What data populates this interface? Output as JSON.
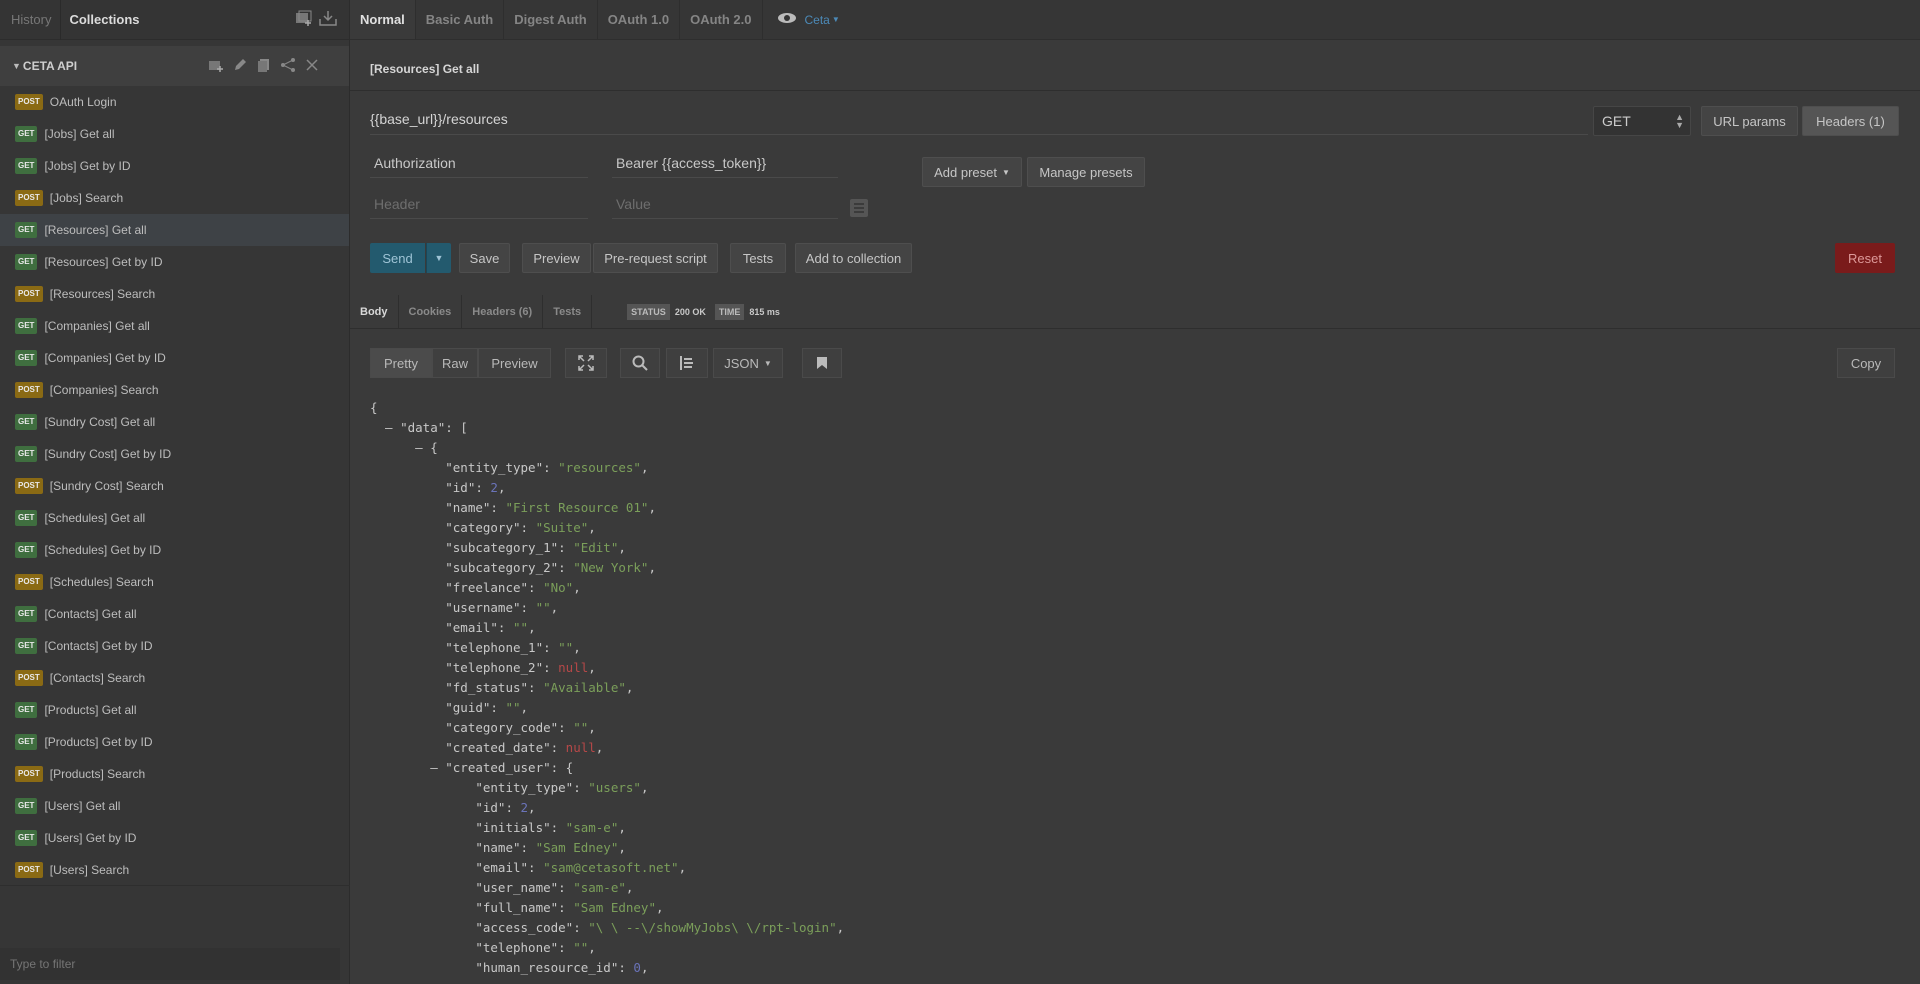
{
  "sidebar": {
    "tabs": [
      {
        "label": "History"
      },
      {
        "label": "Collections"
      }
    ],
    "collection_name": "CETA API",
    "filter_placeholder": "Type to filter",
    "requests": [
      {
        "method": "POST",
        "label": "OAuth Login"
      },
      {
        "method": "GET",
        "label": "[Jobs] Get all"
      },
      {
        "method": "GET",
        "label": "[Jobs] Get by ID"
      },
      {
        "method": "POST",
        "label": "[Jobs] Search"
      },
      {
        "method": "GET",
        "label": "[Resources] Get all"
      },
      {
        "method": "GET",
        "label": "[Resources] Get by ID"
      },
      {
        "method": "POST",
        "label": "[Resources] Search"
      },
      {
        "method": "GET",
        "label": "[Companies] Get all"
      },
      {
        "method": "GET",
        "label": "[Companies] Get by ID"
      },
      {
        "method": "POST",
        "label": "[Companies] Search"
      },
      {
        "method": "GET",
        "label": "[Sundry Cost] Get all"
      },
      {
        "method": "GET",
        "label": "[Sundry Cost] Get by ID"
      },
      {
        "method": "POST",
        "label": "[Sundry Cost] Search"
      },
      {
        "method": "GET",
        "label": "[Schedules] Get all"
      },
      {
        "method": "GET",
        "label": "[Schedules] Get by ID"
      },
      {
        "method": "POST",
        "label": "[Schedules] Search"
      },
      {
        "method": "GET",
        "label": "[Contacts] Get all"
      },
      {
        "method": "GET",
        "label": "[Contacts] Get by ID"
      },
      {
        "method": "POST",
        "label": "[Contacts] Search"
      },
      {
        "method": "GET",
        "label": "[Products] Get all"
      },
      {
        "method": "GET",
        "label": "[Products] Get by ID"
      },
      {
        "method": "POST",
        "label": "[Products] Search"
      },
      {
        "method": "GET",
        "label": "[Users] Get all"
      },
      {
        "method": "GET",
        "label": "[Users] Get by ID"
      },
      {
        "method": "POST",
        "label": "[Users] Search"
      }
    ],
    "active_index": 4
  },
  "auth_tabs": [
    {
      "label": "Normal"
    },
    {
      "label": "Basic Auth"
    },
    {
      "label": "Digest Auth"
    },
    {
      "label": "OAuth 1.0"
    },
    {
      "label": "OAuth 2.0"
    }
  ],
  "environment": "Ceta",
  "request": {
    "title": "[Resources] Get all",
    "url": "{{base_url}}/resources",
    "method": "GET",
    "url_params_label": "URL params",
    "headers_label": "Headers (1)",
    "header_key": "Authorization",
    "header_value": "Bearer {{access_token}}",
    "header_placeholder": "Header",
    "value_placeholder": "Value",
    "add_preset": "Add preset",
    "manage_presets": "Manage presets"
  },
  "actions": {
    "send": "Send",
    "save": "Save",
    "preview": "Preview",
    "prerequest": "Pre-request script",
    "tests": "Tests",
    "add_to_collection": "Add to collection",
    "reset": "Reset"
  },
  "response": {
    "tabs": [
      {
        "label": "Body"
      },
      {
        "label": "Cookies"
      },
      {
        "label": "Headers (6)"
      },
      {
        "label": "Tests"
      }
    ],
    "status_tag": "STATUS",
    "status": "200 OK",
    "time_tag": "TIME",
    "time": "815 ms",
    "view_modes": [
      {
        "label": "Pretty"
      },
      {
        "label": "Raw"
      },
      {
        "label": "Preview"
      }
    ],
    "format": "JSON",
    "copy": "Copy"
  },
  "json_lines": [
    [
      {
        "t": "jt",
        "v": "{"
      }
    ],
    [
      {
        "t": "jt",
        "v": "  – \"data\": ["
      }
    ],
    [
      {
        "t": "jt",
        "v": "      – {"
      }
    ],
    [
      {
        "t": "jk",
        "v": "          \"entity_type\": "
      },
      {
        "t": "js",
        "v": "\"resources\""
      },
      {
        "t": "jt",
        "v": ","
      }
    ],
    [
      {
        "t": "jk",
        "v": "          \"id\": "
      },
      {
        "t": "jn",
        "v": "2"
      },
      {
        "t": "jt",
        "v": ","
      }
    ],
    [
      {
        "t": "jk",
        "v": "          \"name\": "
      },
      {
        "t": "js",
        "v": "\"First Resource 01\""
      },
      {
        "t": "jt",
        "v": ","
      }
    ],
    [
      {
        "t": "jk",
        "v": "          \"category\": "
      },
      {
        "t": "js",
        "v": "\"Suite\""
      },
      {
        "t": "jt",
        "v": ","
      }
    ],
    [
      {
        "t": "jk",
        "v": "          \"subcategory_1\": "
      },
      {
        "t": "js",
        "v": "\"Edit\""
      },
      {
        "t": "jt",
        "v": ","
      }
    ],
    [
      {
        "t": "jk",
        "v": "          \"subcategory_2\": "
      },
      {
        "t": "js",
        "v": "\"New York\""
      },
      {
        "t": "jt",
        "v": ","
      }
    ],
    [
      {
        "t": "jk",
        "v": "          \"freelance\": "
      },
      {
        "t": "js",
        "v": "\"No\""
      },
      {
        "t": "jt",
        "v": ","
      }
    ],
    [
      {
        "t": "jk",
        "v": "          \"username\": "
      },
      {
        "t": "js",
        "v": "\"\""
      },
      {
        "t": "jt",
        "v": ","
      }
    ],
    [
      {
        "t": "jk",
        "v": "          \"email\": "
      },
      {
        "t": "js",
        "v": "\"\""
      },
      {
        "t": "jt",
        "v": ","
      }
    ],
    [
      {
        "t": "jk",
        "v": "          \"telephone_1\": "
      },
      {
        "t": "js",
        "v": "\"\""
      },
      {
        "t": "jt",
        "v": ","
      }
    ],
    [
      {
        "t": "jk",
        "v": "          \"telephone_2\": "
      },
      {
        "t": "jl",
        "v": "null"
      },
      {
        "t": "jt",
        "v": ","
      }
    ],
    [
      {
        "t": "jk",
        "v": "          \"fd_status\": "
      },
      {
        "t": "js",
        "v": "\"Available\""
      },
      {
        "t": "jt",
        "v": ","
      }
    ],
    [
      {
        "t": "jk",
        "v": "          \"guid\": "
      },
      {
        "t": "js",
        "v": "\"\""
      },
      {
        "t": "jt",
        "v": ","
      }
    ],
    [
      {
        "t": "jk",
        "v": "          \"category_code\": "
      },
      {
        "t": "js",
        "v": "\"\""
      },
      {
        "t": "jt",
        "v": ","
      }
    ],
    [
      {
        "t": "jk",
        "v": "          \"created_date\": "
      },
      {
        "t": "jl",
        "v": "null"
      },
      {
        "t": "jt",
        "v": ","
      }
    ],
    [
      {
        "t": "jt",
        "v": "        – \"created_user\": {"
      }
    ],
    [
      {
        "t": "jk",
        "v": "              \"entity_type\": "
      },
      {
        "t": "js",
        "v": "\"users\""
      },
      {
        "t": "jt",
        "v": ","
      }
    ],
    [
      {
        "t": "jk",
        "v": "              \"id\": "
      },
      {
        "t": "jn",
        "v": "2"
      },
      {
        "t": "jt",
        "v": ","
      }
    ],
    [
      {
        "t": "jk",
        "v": "              \"initials\": "
      },
      {
        "t": "js",
        "v": "\"sam-e\""
      },
      {
        "t": "jt",
        "v": ","
      }
    ],
    [
      {
        "t": "jk",
        "v": "              \"name\": "
      },
      {
        "t": "js",
        "v": "\"Sam Edney\""
      },
      {
        "t": "jt",
        "v": ","
      }
    ],
    [
      {
        "t": "jk",
        "v": "              \"email\": "
      },
      {
        "t": "js",
        "v": "\"sam@cetasoft.net\""
      },
      {
        "t": "jt",
        "v": ","
      }
    ],
    [
      {
        "t": "jk",
        "v": "              \"user_name\": "
      },
      {
        "t": "js",
        "v": "\"sam-e\""
      },
      {
        "t": "jt",
        "v": ","
      }
    ],
    [
      {
        "t": "jk",
        "v": "              \"full_name\": "
      },
      {
        "t": "js",
        "v": "\"Sam Edney\""
      },
      {
        "t": "jt",
        "v": ","
      }
    ],
    [
      {
        "t": "jk",
        "v": "              \"access_code\": "
      },
      {
        "t": "js",
        "v": "\"\\ \\ --\\/showMyJobs\\ \\/rpt-login\""
      },
      {
        "t": "jt",
        "v": ","
      }
    ],
    [
      {
        "t": "jk",
        "v": "              \"telephone\": "
      },
      {
        "t": "js",
        "v": "\"\""
      },
      {
        "t": "jt",
        "v": ","
      }
    ],
    [
      {
        "t": "jk",
        "v": "              \"human_resource_id\": "
      },
      {
        "t": "jn",
        "v": "0"
      },
      {
        "t": "jt",
        "v": ","
      }
    ]
  ]
}
